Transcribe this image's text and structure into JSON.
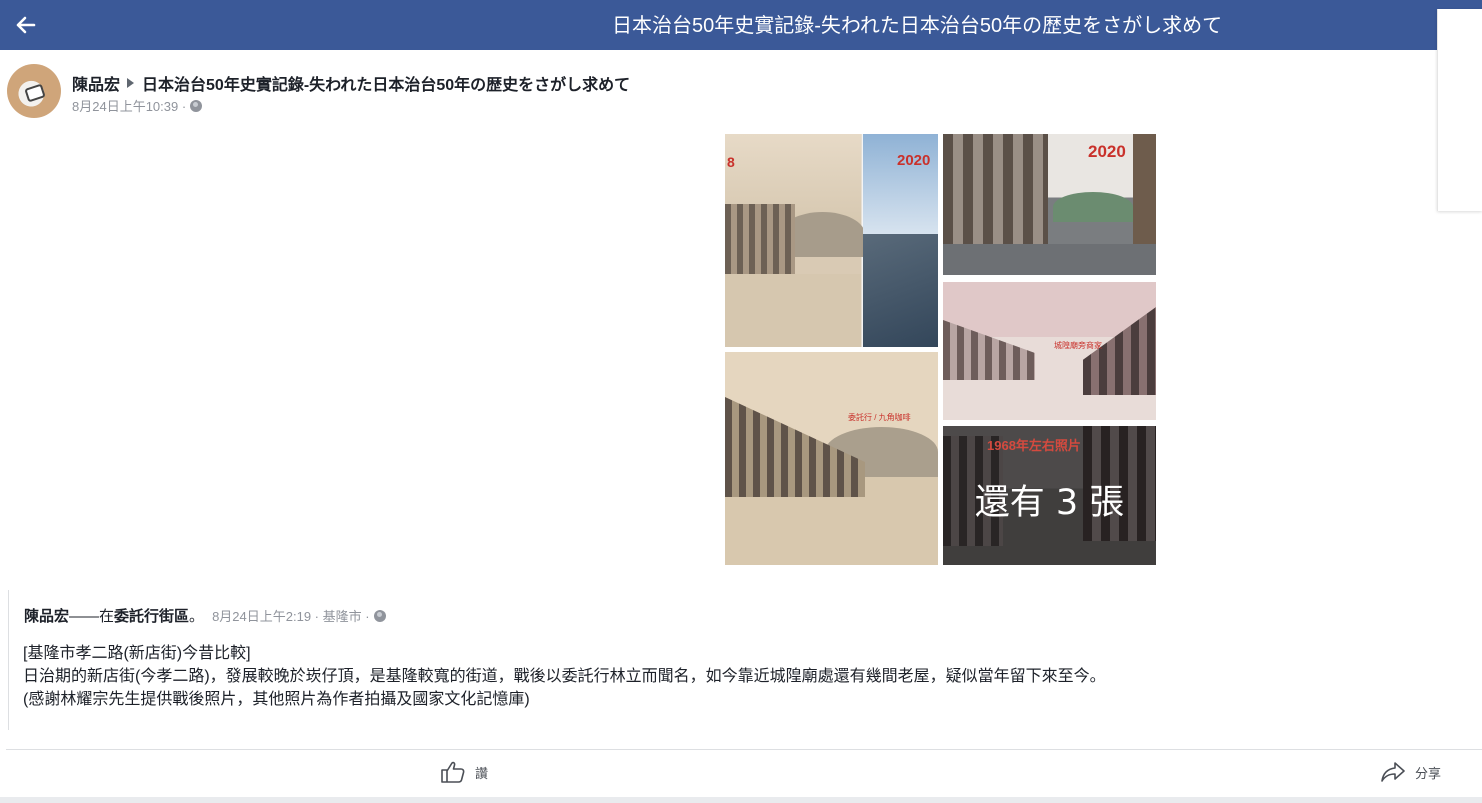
{
  "header": {
    "title": "日本治台50年史實記錄-失われた日本治台50年の歴史をさがし求めて",
    "back_icon": "arrow-left-icon",
    "bg_color": "#3b5998"
  },
  "post": {
    "author": "陳品宏",
    "group": "日本治台50年史實記錄-失われた日本治台50年の歴史をさがし求めて",
    "timestamp": "8月24日上午10:39 ·",
    "privacy_icon": "globe-icon"
  },
  "photos": {
    "p1_label_left": "8",
    "p1_label_right": "2020",
    "p2_label": "2020",
    "p3_label": "城隍廟旁商家",
    "p4_label": "委託行 / 九角咖啡",
    "p5_label": "1968年左右照片",
    "more_label": "還有 3 張"
  },
  "shared": {
    "author": "陳品宏",
    "connector": "——在",
    "location": "委託行街區",
    "period": "。",
    "meta": "8月24日上午2:19 · 基隆市 ·",
    "lines": [
      "[基隆市孝二路(新店街)今昔比較]",
      "日治期的新店街(今孝二路)，發展較晚於崁仔頂，是基隆較寬的街道，戰後以委託行林立而聞名，如今靠近城隍廟處還有幾間老屋，疑似當年留下來至今。",
      "(感謝林耀宗先生提供戰後照片，其他照片為作者拍攝及國家文化記憶庫)"
    ]
  },
  "actions": {
    "like_label": "讚",
    "share_label": "分享"
  }
}
